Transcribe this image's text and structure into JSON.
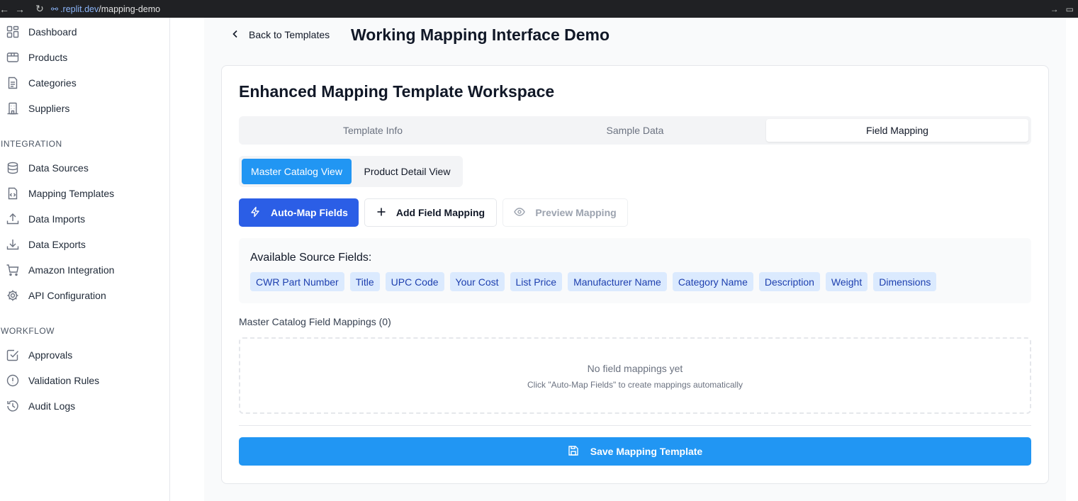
{
  "browser": {
    "url_host": ".replit.dev",
    "url_path": "/mapping-demo"
  },
  "sidebar": {
    "top_items": [
      {
        "label": "Dashboard",
        "icon": "grid-icon"
      },
      {
        "label": "Products",
        "icon": "package-icon"
      },
      {
        "label": "Categories",
        "icon": "file-list-icon"
      },
      {
        "label": "Suppliers",
        "icon": "building-icon"
      }
    ],
    "integration_title": "INTEGRATION",
    "integration_items": [
      {
        "label": "Data Sources",
        "icon": "database-icon"
      },
      {
        "label": "Mapping Templates",
        "icon": "file-code-icon"
      },
      {
        "label": "Data Imports",
        "icon": "upload-icon"
      },
      {
        "label": "Data Exports",
        "icon": "download-icon"
      },
      {
        "label": "Amazon Integration",
        "icon": "cart-icon"
      },
      {
        "label": "API Configuration",
        "icon": "gear-icon"
      }
    ],
    "workflow_title": "WORKFLOW",
    "workflow_items": [
      {
        "label": "Approvals",
        "icon": "check-square-icon"
      },
      {
        "label": "Validation Rules",
        "icon": "alert-circle-icon"
      },
      {
        "label": "Audit Logs",
        "icon": "history-icon"
      }
    ]
  },
  "header": {
    "back_label": "Back to Templates",
    "title": "Working Mapping Interface Demo"
  },
  "card": {
    "title": "Enhanced Mapping Template Workspace",
    "tabs": [
      {
        "label": "Template Info"
      },
      {
        "label": "Sample Data"
      },
      {
        "label": "Field Mapping"
      }
    ],
    "views": {
      "master": "Master Catalog View",
      "detail": "Product Detail View"
    },
    "actions": {
      "auto_map": "Auto-Map Fields",
      "add_mapping": "Add Field Mapping",
      "preview": "Preview Mapping"
    },
    "source_fields_title": "Available Source Fields:",
    "source_fields": [
      "CWR Part Number",
      "Title",
      "UPC Code",
      "Your Cost",
      "List Price",
      "Manufacturer Name",
      "Category Name",
      "Description",
      "Weight",
      "Dimensions"
    ],
    "mappings_label": "Master Catalog Field Mappings (0)",
    "empty_title": "No field mappings yet",
    "empty_sub": "Click \"Auto-Map Fields\" to create mappings automatically",
    "save_label": "Save Mapping Template"
  },
  "colors": {
    "primary": "#2b5ee6",
    "accent_blue": "#2196f3",
    "chip_bg": "#dbeafe",
    "chip_text": "#1e40af"
  }
}
